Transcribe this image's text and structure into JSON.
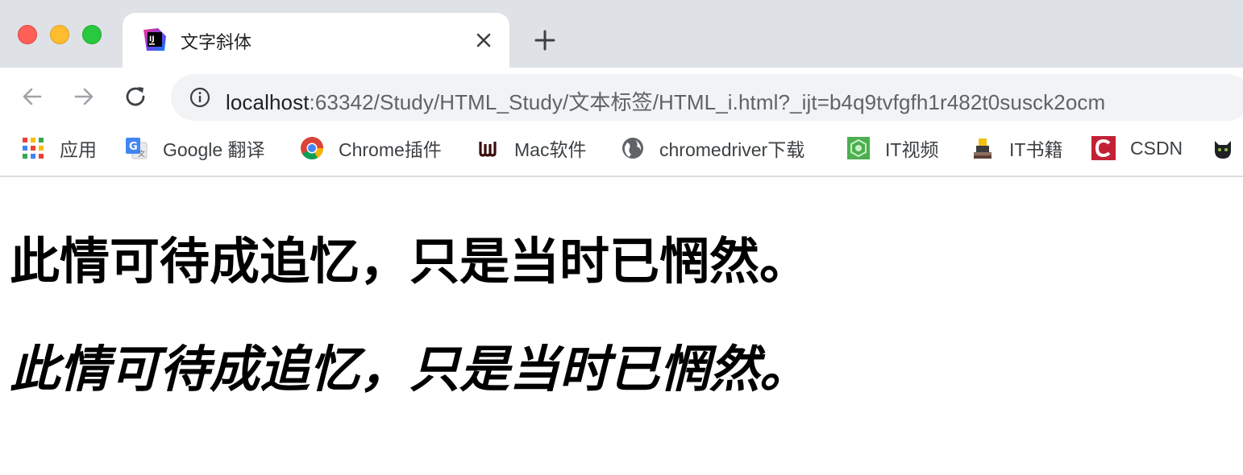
{
  "tab": {
    "title": "文字斜体"
  },
  "address_bar": {
    "host": "localhost",
    "path": ":63342/Study/HTML_Study/文本标签/HTML_i.html?_ijt=b4q9tvfgfh1r482t0susck2ocm"
  },
  "bookmarks": [
    {
      "label": "应用",
      "icon": "apps-grid-icon"
    },
    {
      "label": "Google 翻译",
      "icon": "google-translate-icon"
    },
    {
      "label": "Chrome插件",
      "icon": "chrome-icon"
    },
    {
      "label": "Mac软件",
      "icon": "mac-software-icon"
    },
    {
      "label": "chromedriver下载",
      "icon": "globe-icon"
    },
    {
      "label": "IT视频",
      "icon": "it-video-icon"
    },
    {
      "label": "IT书籍",
      "icon": "it-books-icon"
    },
    {
      "label": "CSDN",
      "icon": "csdn-icon"
    }
  ],
  "page": {
    "normal_text": "此情可待成追忆，只是当时已惘然。",
    "italic_text": "此情可待成追忆，只是当时已惘然。"
  }
}
